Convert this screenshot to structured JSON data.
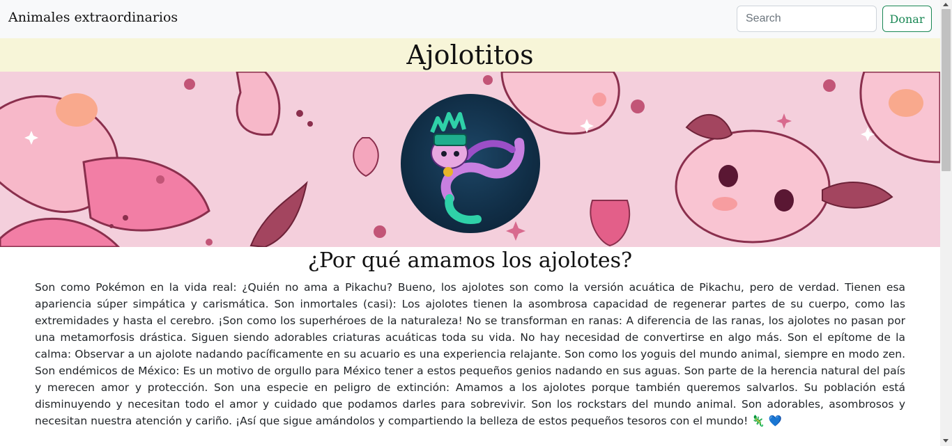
{
  "navbar": {
    "brand": "Animales extraordinarios",
    "search_placeholder": "Search",
    "search_value": "",
    "donate_label": "Donar"
  },
  "header": {
    "title": "Ajolotitos"
  },
  "banner": {
    "image": "kawaii-axolotl-pattern",
    "background_color": "#f4cfdc",
    "logo": "axolotl-aztec-headdress-logo"
  },
  "main": {
    "heading": "¿Por qué amamos los ajolotes?",
    "paragraph": "Son como Pokémon en la vida real: ¿Quién no ama a Pikachu? Bueno, los ajolotes son como la versión acuática de Pikachu, pero de verdad. Tienen esa apariencia súper simpática y carismática. Son inmortales (casi): Los ajolotes tienen la asombrosa capacidad de regenerar partes de su cuerpo, como las extremidades y hasta el cerebro. ¡Son como los superhéroes de la naturaleza! No se transforman en ranas: A diferencia de las ranas, los ajolotes no pasan por una metamorfosis drástica. Siguen siendo adorables criaturas acuáticas toda su vida. No hay necesidad de convertirse en algo más. Son el epítome de la calma: Observar a un ajolote nadando pacíficamente en su acuario es una experiencia relajante. Son como los yoguis del mundo animal, siempre en modo zen. Son endémicos de México: Es un motivo de orgullo para México tener a estos pequeños genios nadando en sus aguas. Son parte de la herencia natural del país y merecen amor y protección. Son una especie en peligro de extinción: Amamos a los ajolotes porque también queremos salvarlos. Su población está disminuyendo y necesitan todo el amor y cuidado que podamos darles para sobrevivir. Son los rockstars del mundo animal. Son adorables, asombrosos y necesitan nuestra atención y cariño. ¡Así que sigue amándolos y compartiendo la belleza de estos pequeños tesoros con el mundo!",
    "emoji_lizard": "🦎",
    "emoji_heart": "💙"
  },
  "colors": {
    "navbar_bg": "#f8f9fa",
    "title_bg": "#f7f5d8",
    "donate_accent": "#198754"
  }
}
